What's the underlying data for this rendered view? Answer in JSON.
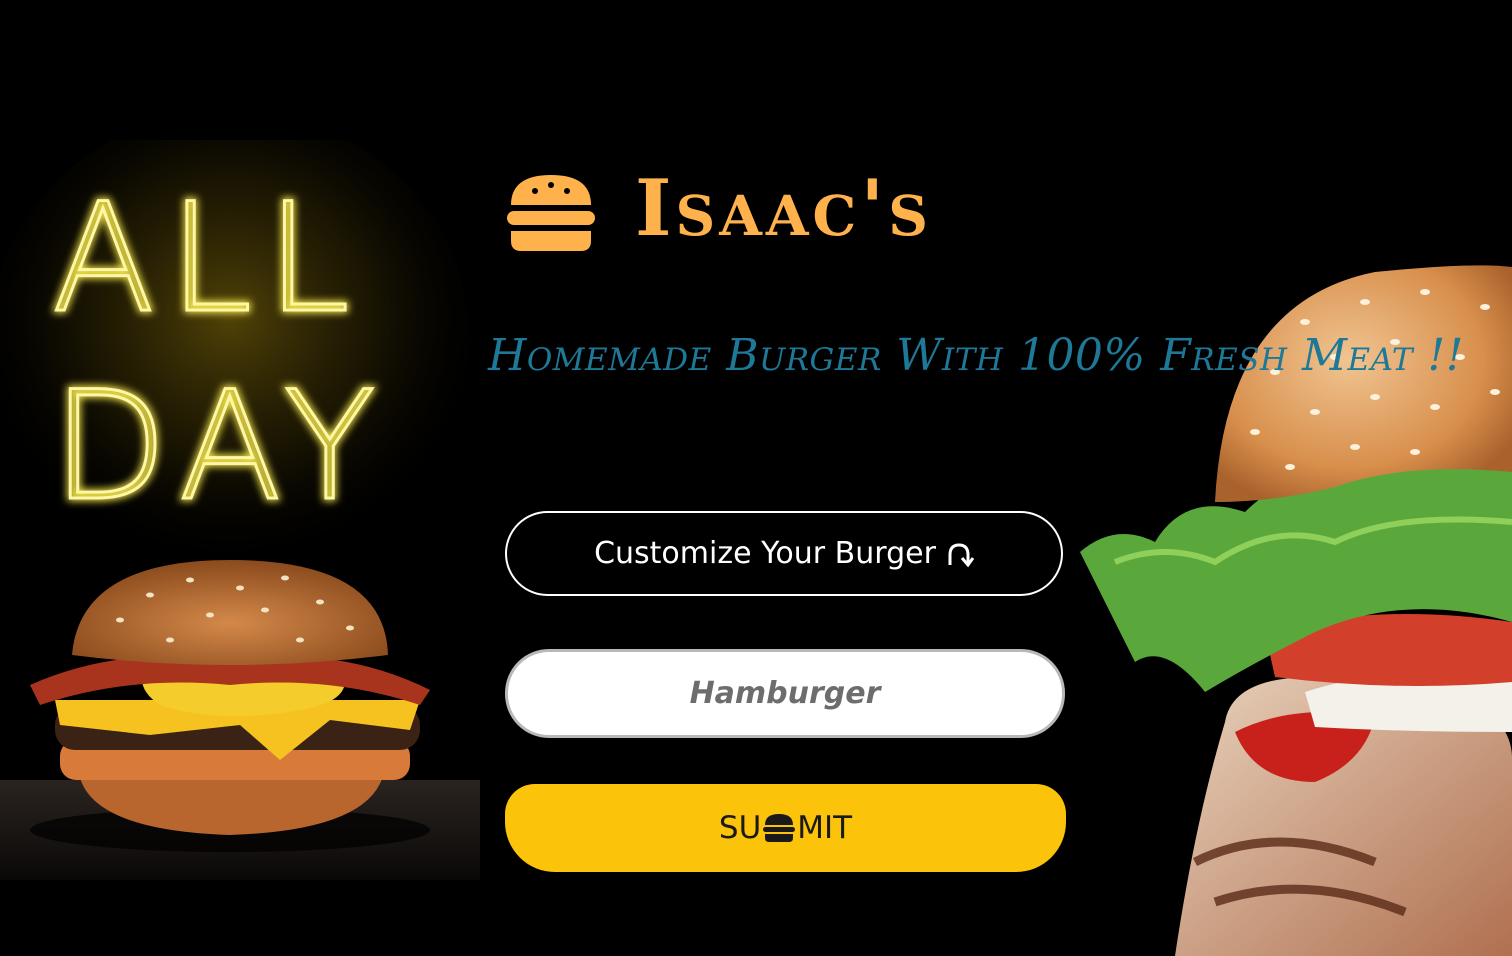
{
  "brand": {
    "name": "Isaac's",
    "icon": "hamburger-icon",
    "color": "#ffb24c"
  },
  "tagline": {
    "text": "Homemade Burger With 100% Fresh Meat !!",
    "color": "#1e7897"
  },
  "hero_left": {
    "neon_line1": "ALL",
    "neon_line2": "DAY"
  },
  "customize": {
    "label": "Customize Your Burger",
    "icon": "curved-arrow-icon"
  },
  "burger_input": {
    "value": "",
    "placeholder": "Hamburger"
  },
  "submit": {
    "label_before": "SU",
    "label_after": "MIT",
    "icon": "hamburger-icon",
    "color": "#fcc30b"
  },
  "colors": {
    "background": "#000000",
    "neon": "#f4e64a"
  }
}
